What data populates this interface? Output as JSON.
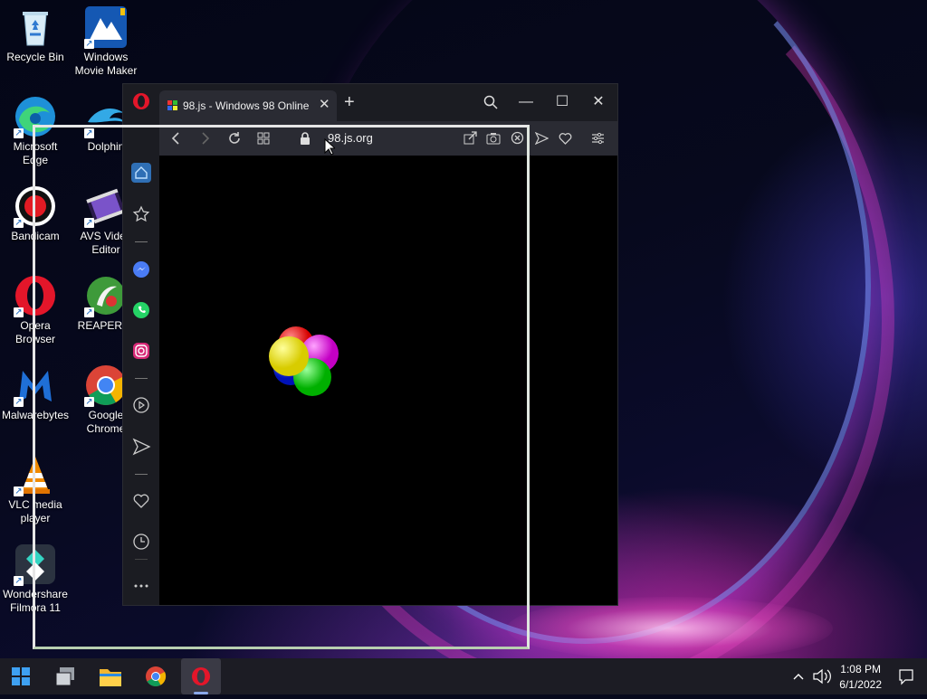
{
  "desktop": {
    "icons": [
      {
        "label": "Recycle Bin",
        "icon": "recycle-bin-icon"
      },
      {
        "label": "Windows Movie Maker",
        "icon": "movie-maker-icon"
      },
      {
        "label": "Microsoft Edge",
        "icon": "edge-icon"
      },
      {
        "label": "Dolphin",
        "icon": "dolphin-icon"
      },
      {
        "label": "Bandicam",
        "icon": "bandicam-icon"
      },
      {
        "label": "AVS Video Editor",
        "icon": "avs-video-editor-icon"
      },
      {
        "label": "Opera Browser",
        "icon": "opera-icon"
      },
      {
        "label": "REAPER (x",
        "icon": "reaper-icon"
      },
      {
        "label": "Malwarebytes",
        "icon": "malwarebytes-icon"
      },
      {
        "label": "Google Chrome",
        "icon": "chrome-icon"
      },
      {
        "label": "VLC media player",
        "icon": "vlc-icon"
      },
      {
        "label": "Wondershare Filmora 11",
        "icon": "filmora-icon"
      }
    ]
  },
  "browser": {
    "tab_title": "98.js - Windows 98 Online",
    "new_tab_symbol": "+",
    "close_tab_symbol": "✕",
    "url": "98.js.org",
    "window_controls": {
      "minimize": "—",
      "maximize": "☐",
      "close": "✕"
    },
    "nav_icons": [
      "back-icon",
      "forward-icon",
      "reload-icon",
      "tabs-grid-icon",
      "lock-icon"
    ],
    "toolbar_icons": [
      "share-icon",
      "snapshot-icon",
      "ad-block-icon",
      "flow-icon",
      "bookmark-heart-icon",
      "easy-setup-icon"
    ],
    "sidebar_icons": [
      "home-icon",
      "star-icon",
      "messenger-icon",
      "whatsapp-icon",
      "instagram-icon",
      "player-icon",
      "send-icon",
      "heart-icon",
      "history-icon",
      "more-icon"
    ],
    "colors": {
      "accent": "#4aa3f5",
      "viewport": "#000000"
    }
  },
  "taskbar": {
    "apps": [
      "start-icon",
      "task-view-icon",
      "file-explorer-icon",
      "chrome-icon",
      "opera-icon"
    ],
    "active_app": "opera-icon",
    "time": "1:08 PM",
    "date": "6/1/2022"
  }
}
